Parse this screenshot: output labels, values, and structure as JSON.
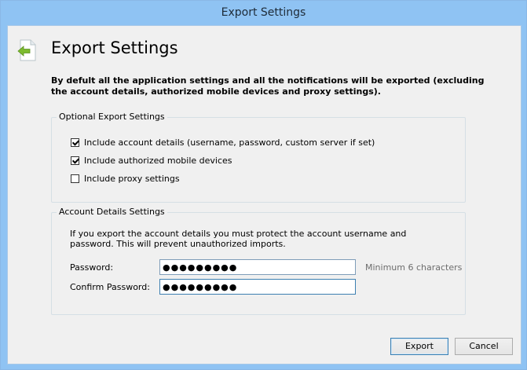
{
  "window": {
    "title": "Export Settings"
  },
  "header": {
    "title": "Export Settings",
    "icon": "export-arrow-icon"
  },
  "description": "By defult all the application settings and all the notifications will be exported (excluding the account details, authorized mobile devices and proxy settings).",
  "optional_group": {
    "legend": "Optional Export Settings",
    "options": [
      {
        "label": "Include account details (username, password, custom server if set)",
        "checked": true
      },
      {
        "label": "Include authorized mobile devices",
        "checked": true
      },
      {
        "label": "Include proxy settings",
        "checked": false
      }
    ]
  },
  "account_group": {
    "legend": "Account Details Settings",
    "info": "If you export the account details you must protect the account username and password. This will prevent unauthorized imports.",
    "password_label": "Password:",
    "password_value": "●●●●●●●●●",
    "password_hint": "Minimum 6 characters",
    "confirm_label": "Confirm Password:",
    "confirm_value": "●●●●●●●●●"
  },
  "buttons": {
    "export": "Export",
    "cancel": "Cancel"
  },
  "colors": {
    "titlebar": "#8fc3f3",
    "accent": "#3c7fb1",
    "hint": "#6d6d6d"
  }
}
